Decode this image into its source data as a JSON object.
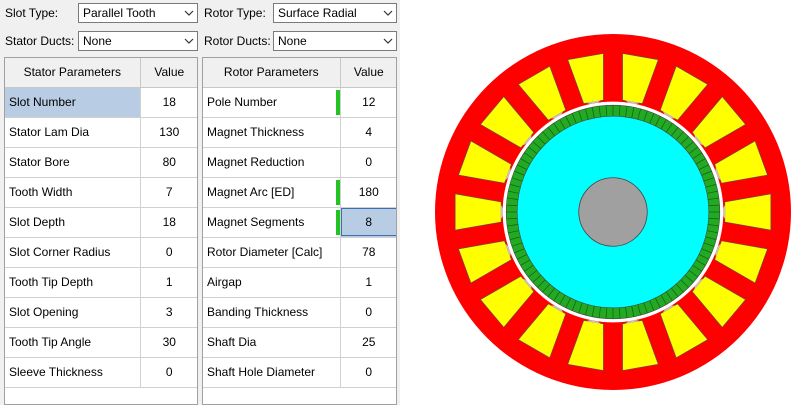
{
  "toolbar": {
    "slot_type_label": "Slot Type:",
    "slot_type_value": "Parallel Tooth",
    "rotor_type_label": "Rotor Type:",
    "rotor_type_value": "Surface Radial",
    "stator_ducts_label": "Stator Ducts:",
    "stator_ducts_value": "None",
    "rotor_ducts_label": "Rotor Ducts:",
    "rotor_ducts_value": "None"
  },
  "stator_table": {
    "col_name": "Stator Parameters",
    "col_value": "Value",
    "rows": [
      {
        "name": "Slot Number",
        "value": "18"
      },
      {
        "name": "Stator Lam Dia",
        "value": "130"
      },
      {
        "name": "Stator Bore",
        "value": "80"
      },
      {
        "name": "Tooth Width",
        "value": "7"
      },
      {
        "name": "Slot Depth",
        "value": "18"
      },
      {
        "name": "Slot Corner Radius",
        "value": "0"
      },
      {
        "name": "Tooth Tip Depth",
        "value": "1"
      },
      {
        "name": "Slot Opening",
        "value": "3"
      },
      {
        "name": "Tooth Tip Angle",
        "value": "30"
      },
      {
        "name": "Sleeve Thickness",
        "value": "0"
      }
    ]
  },
  "rotor_table": {
    "col_name": "Rotor Parameters",
    "col_value": "Value",
    "rows": [
      {
        "name": "Pole Number",
        "value": "12"
      },
      {
        "name": "Magnet Thickness",
        "value": "4"
      },
      {
        "name": "Magnet Reduction",
        "value": "0"
      },
      {
        "name": "Magnet Arc [ED]",
        "value": "180"
      },
      {
        "name": "Magnet Segments",
        "value": "8"
      },
      {
        "name": "Rotor Diameter [Calc]",
        "value": "78"
      },
      {
        "name": "Airgap",
        "value": "1"
      },
      {
        "name": "Banding Thickness",
        "value": "0"
      },
      {
        "name": "Shaft Dia",
        "value": "25"
      },
      {
        "name": "Shaft Hole Diameter",
        "value": "0"
      }
    ]
  },
  "colors": {
    "stator": "#ff0000",
    "winding": "#ffff00",
    "magnet": "#22aa22",
    "rotor": "#00ffff",
    "shaft": "#a0a0a0",
    "selected_cell": "#b8cce4",
    "indicator": "#22c322"
  }
}
